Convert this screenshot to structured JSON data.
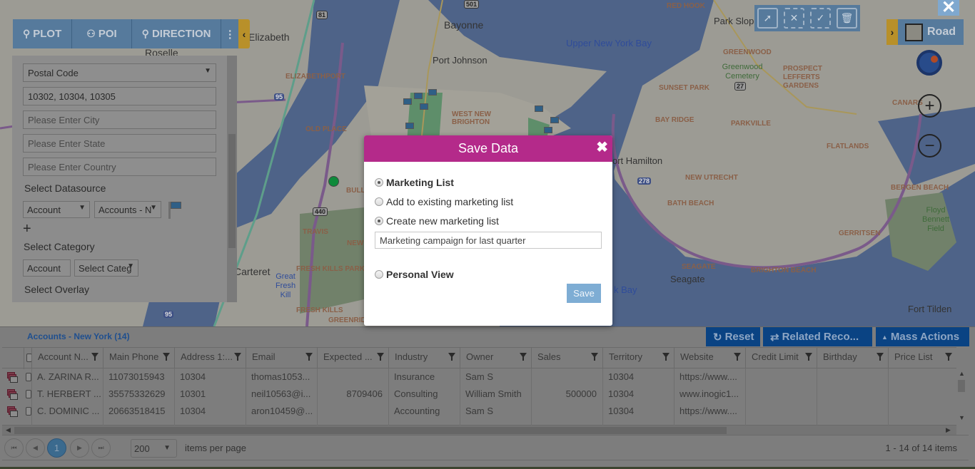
{
  "toolbar": {
    "plot_label": "PLOT",
    "poi_label": "POI",
    "direction_label": "DIRECTION",
    "more_icon": "vertical-ellipsis-icon",
    "collapse_icon": "chevron-left-icon"
  },
  "panel": {
    "search_type": "Postal Code",
    "postal_codes": "10302, 10304, 10305",
    "city_placeholder": "Please Enter City",
    "state_placeholder": "Please Enter State",
    "country_placeholder": "Please Enter Country",
    "datasource_label": "Select Datasource",
    "entity_select": "Account",
    "view_select": "Accounts - N",
    "add_icon": "+",
    "category_label": "Select Category",
    "category_entity": "Account",
    "category_select": "Select Categ",
    "overlay_label": "Select Overlay"
  },
  "map": {
    "close_icon": "✕",
    "road_label": "Road",
    "expand_icon": "chevron-right-icon",
    "zoom_in": "+",
    "zoom_out": "−",
    "labels": {
      "elizabeth": "Elizabeth",
      "roselle": "Roselle",
      "bayonne": "Bayonne",
      "port_johnson": "Port Johnson",
      "upper_ny_bay": "Upper New York Bay",
      "red_hook": "RED HOOK",
      "park_slope": "Park Slope",
      "greenwood": "GREENWOOD",
      "greenwood_cemetery": "Greenwood Cemetery",
      "prospect_lefferts": "PROSPECT LEFFERTS GARDENS",
      "sunset_park": "SUNSET PARK",
      "elizabethport": "ELIZABETHPORT",
      "old_place": "OLD PLACE",
      "west_new_brighton": "WEST NEW BRIGHTON",
      "bay_ridge": "BAY RIDGE",
      "parkville": "PARKVILLE",
      "flatlands": "FLATLANDS",
      "canarsie": "CANARS",
      "fort_hamilton": "ort Hamilton",
      "new_utrecht": "NEW UTRECHT",
      "bath_beach": "BATH BEACH",
      "bergen_beach": "BERGEN BEACH",
      "floyd_bennett": "Floyd Bennett Field",
      "gerritsen": "GERRITSEN",
      "seagate_caps": "SEAGATE",
      "seagate": "Seagate",
      "brighton_beach": "BRIGHTON BEACH",
      "fort_tilden": "Fort Tilden",
      "k_bay": "k Bay",
      "travis": "TRAVIS",
      "bulls": "BULLS",
      "new": "NEW",
      "carteret": "Carteret",
      "great_fresh_kill": "Great Fresh Kill",
      "fresh_kills_park": "FRESH KILLS PARK",
      "fresh_kills": "FRESH KILLS",
      "greenridge": "GREENRID",
      "route_440": "440",
      "route_95": "95",
      "route_278": "278",
      "route_81": "81",
      "route_501": "501",
      "route_27": "27"
    }
  },
  "modal": {
    "title": "Save Data",
    "close_icon": "✖",
    "options": [
      {
        "label": "Marketing List",
        "checked": true
      },
      {
        "label": "Add to existing marketing list",
        "checked": false
      },
      {
        "label": "Create new marketing list",
        "checked": true
      },
      {
        "label": "Personal View",
        "checked": false
      }
    ],
    "list_name": "Marketing campaign for last quarter",
    "save_label": "Save"
  },
  "grid": {
    "title": "Accounts - New York (14)",
    "reset_label": "Reset",
    "related_label": "Related Reco...",
    "mass_actions_label": "Mass Actions",
    "columns": [
      "Account N...",
      "Main Phone",
      "Address 1:...",
      "Email",
      "Expected ...",
      "Industry",
      "Owner",
      "Sales",
      "Territory",
      "Website",
      "Credit Limit",
      "Birthday",
      "Price List"
    ],
    "rows": [
      [
        "A. ZARINA R...",
        "11073015943",
        "10304",
        "thomas1053...",
        "",
        "Insurance",
        "Sam S",
        "",
        "10304",
        "https://www....",
        "",
        "",
        ""
      ],
      [
        "T. HERBERT ...",
        "35575332629",
        "10301",
        "neil10563@i...",
        "8709406",
        "Consulting",
        "William Smith",
        "500000",
        "10304",
        "www.inogic1...",
        "",
        "",
        ""
      ],
      [
        "C. DOMINIC ...",
        "20663518415",
        "10304",
        "aron10459@...",
        "",
        "Accounting",
        "Sam S",
        "",
        "10304",
        "https://www....",
        "",
        "",
        ""
      ]
    ],
    "pager": {
      "current_page": "1",
      "page_size": "200",
      "items_per_page_label": "items per page",
      "info": "1 - 14 of 14 items"
    }
  },
  "colors": {
    "modal_header": "#b42a8a",
    "grid_button": "#0a4383",
    "toolbar": "#567a9c",
    "accent_gold": "#b8902a",
    "save_button": "#7eadd4"
  }
}
